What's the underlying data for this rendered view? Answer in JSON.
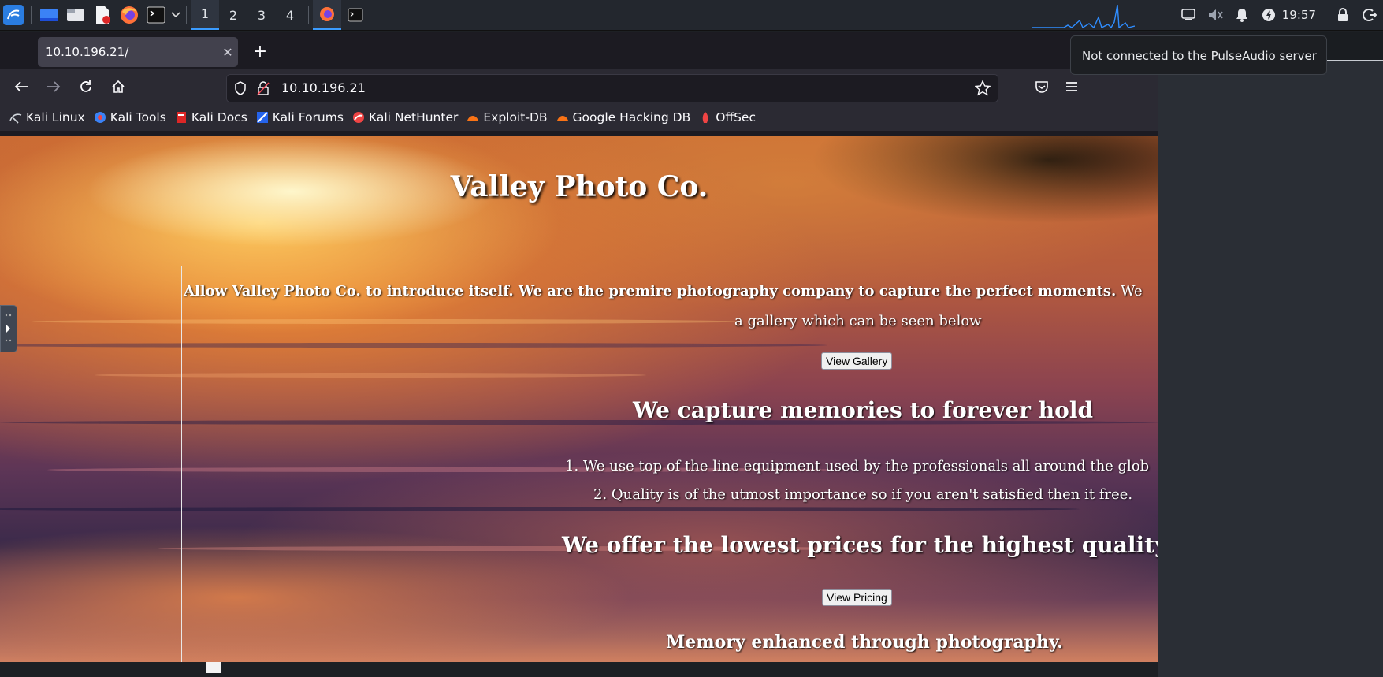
{
  "taskbar": {
    "workspaces": [
      "1",
      "2",
      "3",
      "4"
    ],
    "active_workspace": "1",
    "clock": "19:57"
  },
  "tooltip": {
    "text": "Not connected to the PulseAudio server"
  },
  "browser": {
    "tab_title": "10.10.196.21/",
    "url": "10.10.196.21",
    "bookmarks": [
      "Kali Linux",
      "Kali Tools",
      "Kali Docs",
      "Kali Forums",
      "Kali NetHunter",
      "Exploit-DB",
      "Google Hacking DB",
      "OffSec"
    ]
  },
  "page": {
    "title": "Valley Photo Co.",
    "intro_bold": "Allow Valley Photo Co. to introduce itself. We are the premire photography company to capture the perfect moments.",
    "intro_rest": " We",
    "intro_line2": "a gallery which can be seen below",
    "gallery_button": "View Gallery",
    "heading_capture": "We capture memories to forever hold",
    "list_item_1": "1. We use top of the line equipment used by the professionals all around the glob",
    "list_item_2": "2. Quality is of the utmost importance so if you aren't satisfied then it free.",
    "heading_prices": "We offer the lowest prices for the highest quality",
    "pricing_button": "View Pricing",
    "heading_memory": "Memory enhanced through photography."
  },
  "colors": {
    "accent": "#3b9cff",
    "panel_bg": "#23272e",
    "firefox_toolbar": "#2b2a33"
  }
}
